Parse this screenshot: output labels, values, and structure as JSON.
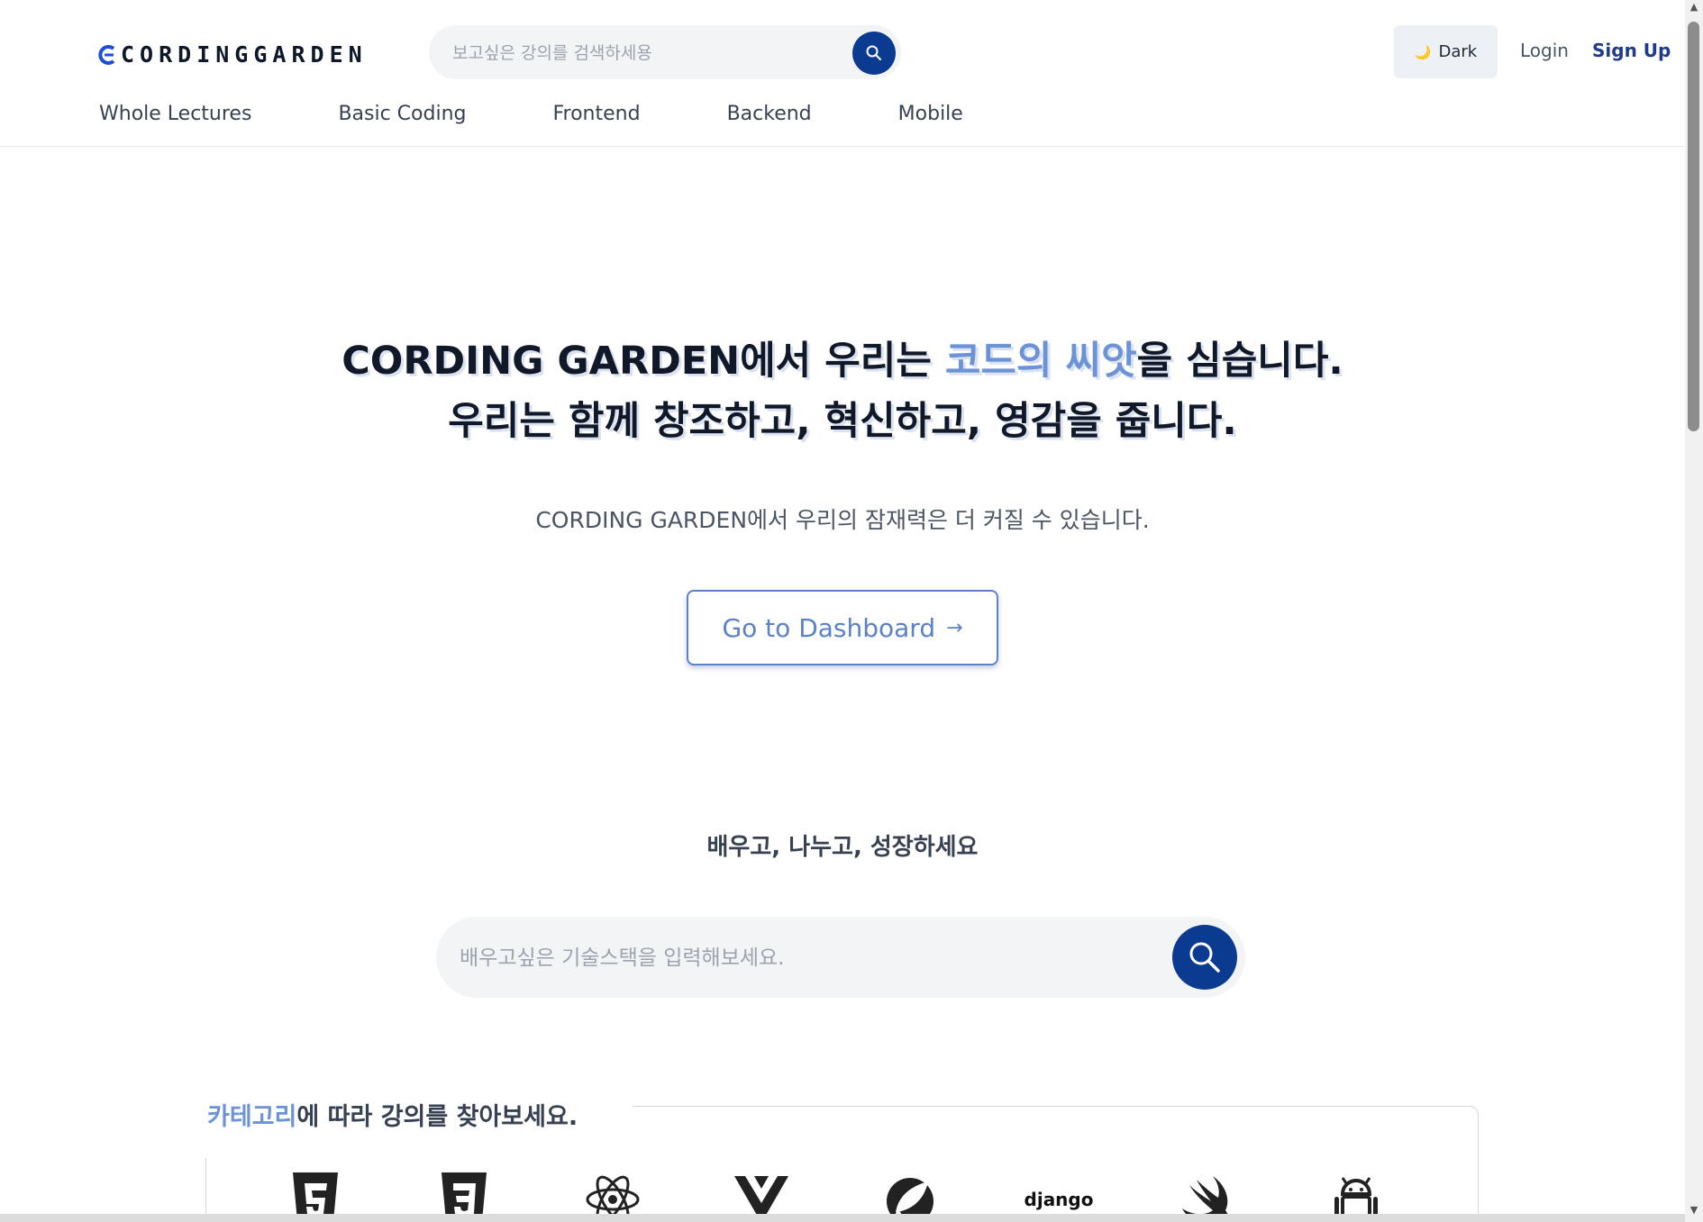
{
  "header": {
    "logo_text": "CORDINGGARDEN",
    "search_placeholder": "보고싶은 강의를 검색하세용",
    "theme_label": "Dark",
    "login_label": "Login",
    "signup_label": "Sign Up",
    "nav": [
      "Whole Lectures",
      "Basic Coding",
      "Frontend",
      "Backend",
      "Mobile"
    ]
  },
  "hero": {
    "line1_pre": "CORDING GARDEN에서 우리는 ",
    "line1_accent": "코드의 씨앗",
    "line1_post": "을 심습니다.",
    "line2": "우리는 함께 창조하고, 혁신하고, 영감을 줍니다.",
    "subtitle": "CORDING GARDEN에서 우리의 잠재력은 더 커질 수 있습니다.",
    "cta_label": "Go to Dashboard",
    "cta_arrow": "→"
  },
  "learn": {
    "title": "배우고, 나누고, 성장하세요",
    "search_placeholder": "배우고싶은 기술스택을 입력해보세요."
  },
  "categories": {
    "title_accent": "카테고리",
    "title_rest": "에 따라 강의를 찾아보세요.",
    "icons": [
      "html5-icon",
      "css3-icon",
      "react-icon",
      "vue-icon",
      "spring-icon",
      "django-icon",
      "swift-icon",
      "android-icon"
    ],
    "django_text": "django"
  },
  "colors": {
    "brand_navy": "#0b3a91",
    "accent_blue": "#6b93d6"
  }
}
